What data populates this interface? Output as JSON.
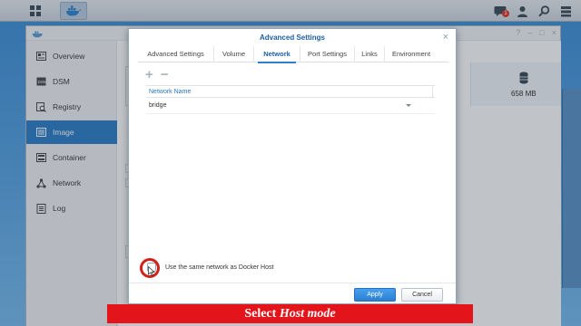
{
  "taskbar": {
    "main_menu_icon": "grid-icon",
    "app_icon": "docker-whale-icon",
    "notification_count": "1",
    "right_icons": [
      "chat-icon",
      "user-icon",
      "search-icon",
      "widgets-icon"
    ]
  },
  "app": {
    "sidebar": {
      "items": [
        {
          "label": "Overview",
          "icon": "overview-icon"
        },
        {
          "label": "DSM",
          "icon": "dsm-icon"
        },
        {
          "label": "Registry",
          "icon": "registry-icon"
        },
        {
          "label": "Image",
          "icon": "image-icon"
        },
        {
          "label": "Container",
          "icon": "container-icon"
        },
        {
          "label": "Network",
          "icon": "network-icon"
        },
        {
          "label": "Log",
          "icon": "log-icon"
        }
      ],
      "active": "Image"
    },
    "storage_value": "658 MB"
  },
  "dialog": {
    "title": "Advanced Settings",
    "tabs": [
      "Advanced Settings",
      "Volume",
      "Network",
      "Port Settings",
      "Links",
      "Environment"
    ],
    "active_tab": "Network",
    "table": {
      "column": "Network Name",
      "rows": [
        "bridge"
      ]
    },
    "host_option_label": "Use the same network as Docker Host",
    "apply_label": "Apply",
    "cancel_label": "Cancel"
  },
  "caption": {
    "prefix": "Select ",
    "emphasis": "Host mode"
  },
  "colors": {
    "accent": "#2e80cb",
    "highlight": "#d1221a",
    "caption_bg": "#e4141b"
  }
}
